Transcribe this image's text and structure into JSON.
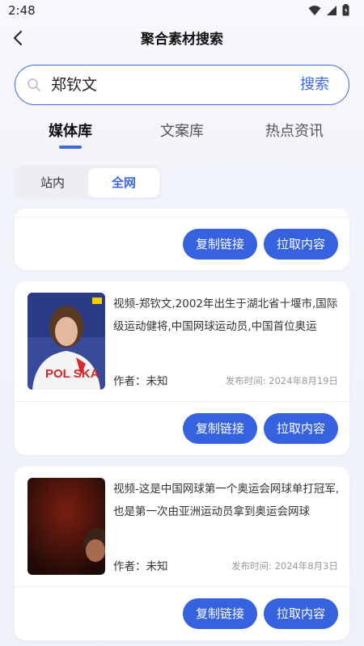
{
  "status_bar": {
    "time": "2:48"
  },
  "header": {
    "title": "聚合素材搜索"
  },
  "search": {
    "value": "郑钦文",
    "button_label": "搜索"
  },
  "tabs": [
    {
      "label": "媒体库",
      "active": true
    },
    {
      "label": "文案库",
      "active": false
    },
    {
      "label": "热点资讯",
      "active": false
    }
  ],
  "scope_switch": [
    {
      "label": "站内",
      "active": false
    },
    {
      "label": "全网",
      "active": true
    }
  ],
  "actions": {
    "copy_link": "复制链接",
    "pull_content": "拉取内容"
  },
  "results": [
    {
      "description": "视频-郑钦文,2002年出生于湖北省十堰市,国际级运动健将,中国网球运动员,中国首位奥运",
      "author": "作者：未知",
      "published": "发布时间: 2024年8月19日",
      "thumb_text": "POL SKA"
    },
    {
      "description": "视频-这是中国网球第一个奥运会网球单打冠军,也是第一次由亚洲运动员拿到奥运会网球",
      "author": "作者：未知",
      "published": "发布时间: 2024年8月3日"
    }
  ],
  "colors": {
    "accent": "#3662e0",
    "background": "#f2f4fb"
  }
}
